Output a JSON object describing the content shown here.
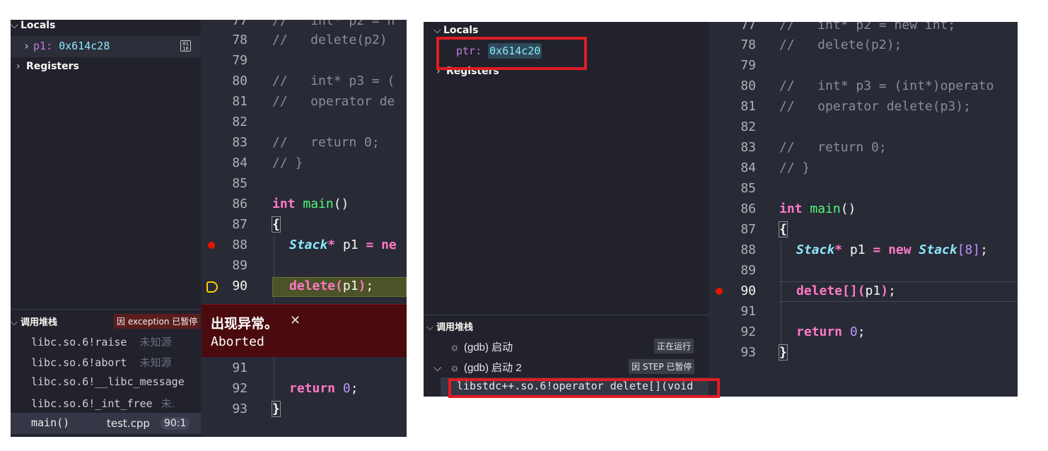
{
  "left": {
    "locals_header": "Locals",
    "var": {
      "name": "p1",
      "sep": ":",
      "value": "0x614c28"
    },
    "binary_icon": "binary-icon",
    "registers_header": "Registers",
    "callstack_header": "调用堆栈",
    "pause_badge": "因 exception 已暂停",
    "frames": [
      {
        "name": "libc.so.6!raise",
        "note": "未知源"
      },
      {
        "name": "libc.so.6!abort",
        "note": "未知源"
      },
      {
        "name": "libc.so.6!__libc_message",
        "note": ""
      },
      {
        "name": "libc.so.6!_int_free",
        "note": "未."
      }
    ],
    "selected_frame": {
      "name": "main()",
      "file": "test.cpp",
      "pos": "90:1"
    },
    "exception": {
      "title": "出现异常。",
      "close": "✕",
      "message": "Aborted"
    },
    "code": {
      "n77": "77",
      "n78": "78",
      "n79": "79",
      "n80": "80",
      "n81": "81",
      "n82": "82",
      "n83": "83",
      "n84": "84",
      "n85": "85",
      "n86": "86",
      "n87": "87",
      "n88": "88",
      "n89": "89",
      "n90": "90",
      "n91": "91",
      "n92": "92",
      "n93": "93",
      "l77": "//   int* p2 = n",
      "l78": "//   delete(p2)",
      "l80": "//   int* p3 = (",
      "l81": "//   operator de",
      "l83": "//   return 0;",
      "l84": "// }",
      "l86_kw": "int",
      "l86_fn": "main",
      "l86_rest": "()",
      "l87": "{",
      "l88_ty": "Stack",
      "l88_op": "*",
      "l88_var": " p1 ",
      "l88_eq": "=",
      "l88_kw": " ne",
      "l90_fn": "delete",
      "l90_p1": "(",
      "l90_arg": "p1",
      "l90_p2": ")",
      "l90_semi": ";",
      "l92_kw": "return",
      "l92_num": "0",
      "l92_semi": ";",
      "l93": "}"
    }
  },
  "right": {
    "locals_header": "Locals",
    "var": {
      "name": "ptr",
      "sep": ":",
      "value": "0x614c20"
    },
    "registers_header": "Registers",
    "callstack_header": "调用堆栈",
    "sessions": [
      {
        "label": "(gdb) 启动",
        "badge": "正在运行"
      },
      {
        "label": "(gdb) 启动 2",
        "badge": "因 STEP 已暂停"
      }
    ],
    "frame": "libstdc++.so.6!operator delete[](void",
    "code": {
      "n77": "77",
      "n78": "78",
      "n79": "79",
      "n80": "80",
      "n81": "81",
      "n82": "82",
      "n83": "83",
      "n84": "84",
      "n85": "85",
      "n86": "86",
      "n87": "87",
      "n88": "88",
      "n89": "89",
      "n90": "90",
      "n91": "91",
      "n92": "92",
      "n93": "93",
      "l77": "//   int* p2 = new int;",
      "l78": "//   delete(p2);",
      "l80": "//   int* p3 = (int*)operato",
      "l81": "//   operator delete(p3);",
      "l83": "//   return 0;",
      "l84": "// }",
      "l86_kw": "int",
      "l86_fn": "main",
      "l86_rest": "()",
      "l87": "{",
      "l88_ty": "Stack",
      "l88_op": "*",
      "l88_var": " p1 ",
      "l88_eq": "=",
      "l88_new": " new ",
      "l88_ty2": "Stack",
      "l88_b1": "[",
      "l88_num": "8",
      "l88_b2": "]",
      "l88_semi": ";",
      "l90_fn": "delete[]",
      "l90_p1": "(",
      "l90_arg": "p1",
      "l90_p2": ")",
      "l90_semi": ";",
      "l92_kw": "return",
      "l92_sp": " ",
      "l92_num": "0",
      "l92_semi": ";",
      "l93": "}"
    }
  },
  "colors": {
    "annotation_red": "#e01c24",
    "breakpoint": "#e51400",
    "current_line": "#ffcc00"
  }
}
